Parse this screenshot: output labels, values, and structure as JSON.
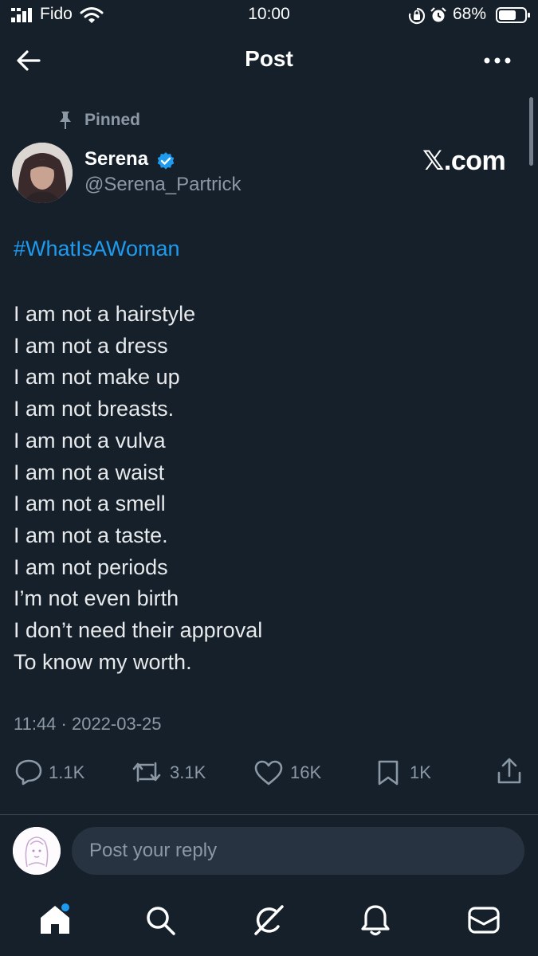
{
  "status_bar": {
    "carrier": "Fido",
    "time": "10:00",
    "battery_percent": "68%",
    "icons": [
      "signal-icon",
      "wifi-icon",
      "orientation-lock-icon",
      "alarm-icon",
      "battery-icon"
    ]
  },
  "header": {
    "title": "Post",
    "back_icon": "back-arrow-icon",
    "more_icon": "more-options-icon"
  },
  "post": {
    "pinned_label": "Pinned",
    "author": {
      "display_name": "Serena",
      "handle": "@Serena_Partrick",
      "verified": true
    },
    "watermark": "𝕏.com",
    "hashtag": "#WhatIsAWoman",
    "lines": [
      "I am not a hairstyle",
      "I am not a dress",
      "I am not make up",
      "I am not breasts.",
      "I am not a vulva",
      "I am not a waist",
      "I am not a smell",
      "I am not a taste.",
      "I am not periods",
      "I’m not even birth",
      "I don’t need their approval",
      "To know my worth."
    ],
    "timestamp": "11:44 · 2022-03-25",
    "stats": {
      "replies": "1.1K",
      "reposts": "3.1K",
      "likes": "16K",
      "bookmarks": "1K"
    }
  },
  "reply": {
    "placeholder": "Post your reply"
  },
  "bottom_nav": {
    "items": [
      "home-icon",
      "search-icon",
      "grok-icon",
      "notifications-icon",
      "messages-icon"
    ]
  },
  "colors": {
    "background": "#15202b",
    "accent": "#1d9bf0",
    "muted_text": "#8b98a5",
    "divider": "#38444d"
  }
}
